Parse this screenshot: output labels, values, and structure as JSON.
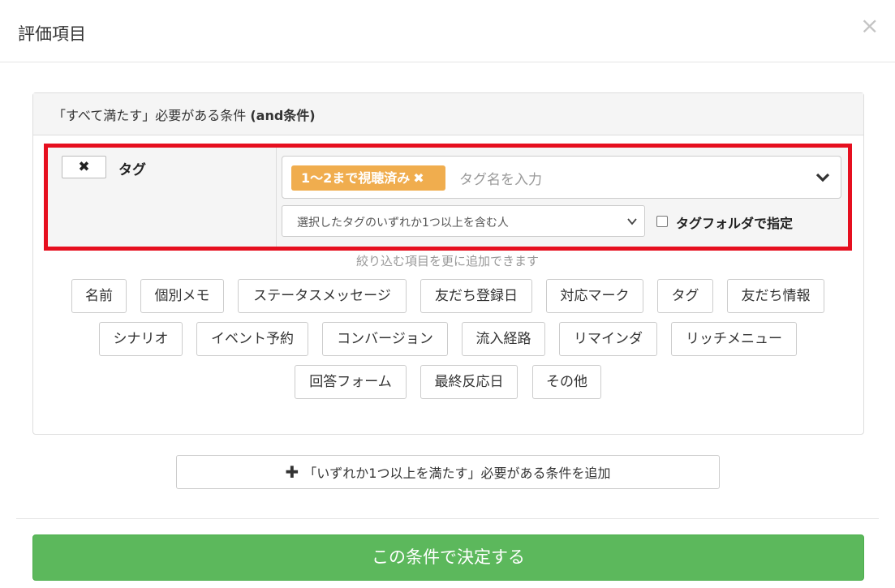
{
  "modal": {
    "title": "評価項目",
    "close_glyph": "×"
  },
  "and_panel": {
    "heading_prefix": "「すべて満たす」必要がある条件 ",
    "heading_bold": "(and条件)"
  },
  "condition": {
    "remove_glyph": "✖",
    "label": "タグ",
    "tag_chip": "1～2まで視聴済み",
    "tag_chip_remove": "✖",
    "tag_placeholder": "タグ名を入力",
    "match_select": "選択したタグのいずれか1つ以上を含む人",
    "folder_checkbox_label": "タグフォルダで指定",
    "folder_checked": false,
    "chip_color": "#f0ad4e",
    "highlight_color": "#e60f1f"
  },
  "hint": "絞り込む項目を更に追加できます",
  "filter_buttons": [
    "名前",
    "個別メモ",
    "ステータスメッセージ",
    "友だち登録日",
    "対応マーク",
    "タグ",
    "友だち情報",
    "シナリオ",
    "イベント予約",
    "コンバージョン",
    "流入経路",
    "リマインダ",
    "リッチメニュー",
    "回答フォーム",
    "最終反応日",
    "その他"
  ],
  "add_or": {
    "icon": "plus-icon",
    "label": "「いずれか1つ以上を満たす」必要がある条件を追加"
  },
  "submit": {
    "label": "この条件で決定する",
    "color": "#5cb85c"
  }
}
